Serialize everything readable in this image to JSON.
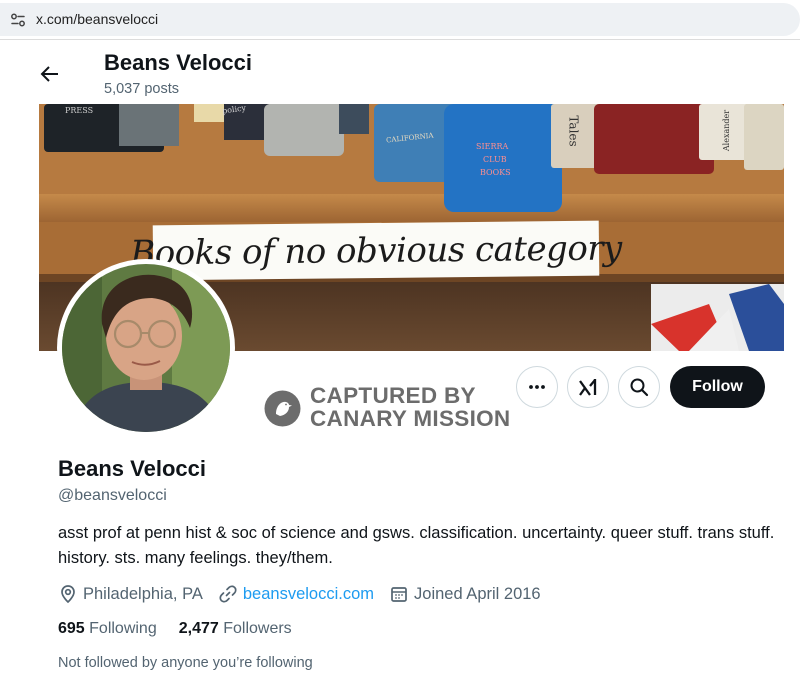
{
  "browser": {
    "url": "x.com/beansvelocci"
  },
  "header": {
    "name": "Beans Velocci",
    "posts_count": "5,037 posts"
  },
  "banner": {
    "sign_text": "Books of no obvious category",
    "book_labels": [
      "PRESS",
      "policy",
      "CALIFORNIA",
      "SIERRA",
      "CLUB",
      "BOOKS",
      "Tales",
      "Alexander"
    ]
  },
  "watermark": {
    "line1": "CAPTURED BY",
    "line2": "CANARY MISSION"
  },
  "actions": {
    "follow_label": "Follow"
  },
  "profile": {
    "display_name": "Beans Velocci",
    "handle": "@beansvelocci",
    "bio": "asst prof at penn hist & soc of science and gsws. classification. uncertainty. queer stuff. trans stuff. history. sts. many feelings. they/them.",
    "location": "Philadelphia, PA",
    "website": "beansvelocci.com",
    "joined": "Joined April 2016",
    "following_count": "695",
    "following_label": "Following",
    "followers_count": "2,477",
    "followers_label": "Followers",
    "not_followed_text": "Not followed by anyone you’re following"
  },
  "icons": {
    "site_info": "site-info-icon",
    "back": "arrow-left-icon",
    "more": "more-horizontal-icon",
    "grok": "grok-icon",
    "search": "search-icon",
    "location": "location-pin-icon",
    "link": "link-icon",
    "calendar": "calendar-icon",
    "watermark": "canary-bird-icon"
  },
  "colors": {
    "accent_link": "#1d9bf0",
    "follow_bg": "#0f1419",
    "secondary_text": "#536471",
    "watermark_text": "#6c6c6c"
  }
}
